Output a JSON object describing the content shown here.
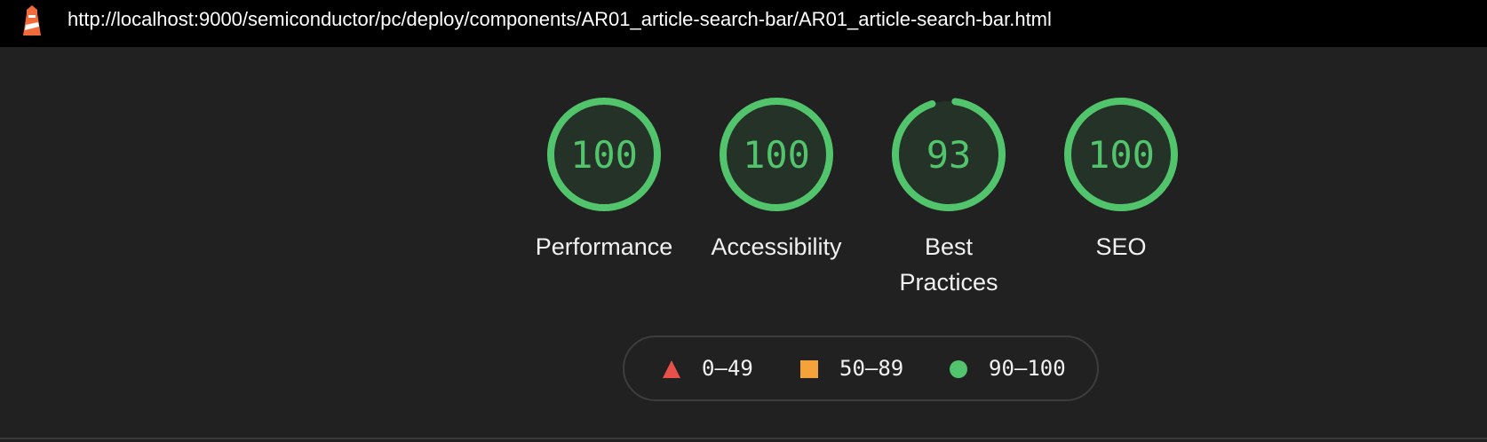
{
  "address_bar": {
    "url": "http://localhost:9000/semiconductor/pc/deploy/components/AR01_article-search-bar/AR01_article-search-bar.html",
    "logo_icon": "lighthouse-icon"
  },
  "scores": [
    {
      "label": "Performance",
      "score": "100",
      "value": 100,
      "color": "#52c46c"
    },
    {
      "label": "Accessibility",
      "score": "100",
      "value": 100,
      "color": "#52c46c"
    },
    {
      "label": "Best Practices",
      "score": "93",
      "value": 93,
      "color": "#52c46c"
    },
    {
      "label": "SEO",
      "score": "100",
      "value": 100,
      "color": "#52c46c"
    }
  ],
  "legend": [
    {
      "range": "0–49",
      "icon": "triangle-icon",
      "color": "#e8504a"
    },
    {
      "range": "50–89",
      "icon": "square-icon",
      "color": "#f4a33a"
    },
    {
      "range": "90–100",
      "icon": "circle-icon",
      "color": "#52c46c"
    }
  ]
}
